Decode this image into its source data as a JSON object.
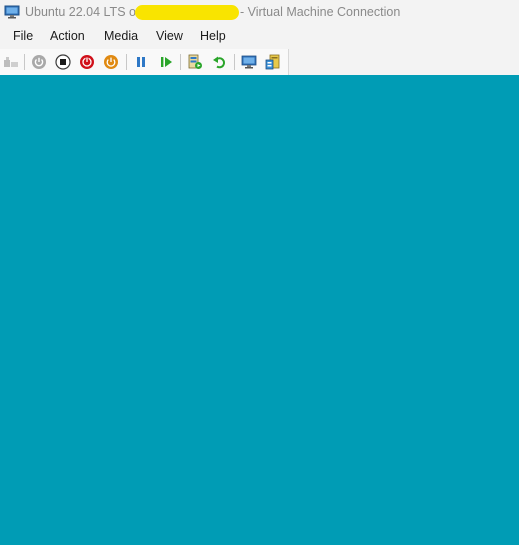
{
  "window": {
    "title_prefix": "Ubuntu 22.04 LTS on",
    "title_suffix": "- Virtual Machine Connection",
    "app_icon": "vm-monitor-icon"
  },
  "menu": {
    "items": [
      {
        "label": "File"
      },
      {
        "label": "Action"
      },
      {
        "label": "Media"
      },
      {
        "label": "View"
      },
      {
        "label": "Help"
      }
    ]
  },
  "toolbar": {
    "buttons": [
      {
        "icon": "ctrl-alt-del-icon",
        "enabled": false
      },
      {
        "icon": "start-icon",
        "enabled": false
      },
      {
        "icon": "turn-off-icon",
        "enabled": true
      },
      {
        "icon": "shut-down-icon",
        "enabled": true
      },
      {
        "icon": "save-state-icon",
        "enabled": true
      },
      {
        "icon": "pause-icon",
        "enabled": true
      },
      {
        "icon": "reset-icon",
        "enabled": true
      },
      {
        "icon": "checkpoint-icon",
        "enabled": true
      },
      {
        "icon": "revert-icon",
        "enabled": true
      },
      {
        "icon": "enhanced-session-icon",
        "enabled": true
      },
      {
        "icon": "share-icon",
        "enabled": true
      }
    ]
  },
  "colors": {
    "vm_screen": "#009cb5",
    "redaction": "#f9e400",
    "chrome": "#f3f3f3"
  }
}
